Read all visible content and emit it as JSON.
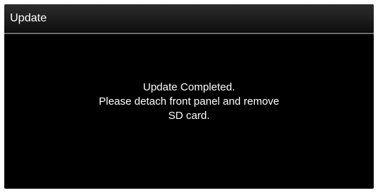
{
  "header": {
    "title": "Update"
  },
  "message": {
    "lines": [
      "Update Completed.",
      "Please detach front panel and remove",
      "SD card."
    ]
  },
  "colors": {
    "background": "#000000",
    "text": "#ffffff",
    "header_separator": "#6a6a6a"
  }
}
